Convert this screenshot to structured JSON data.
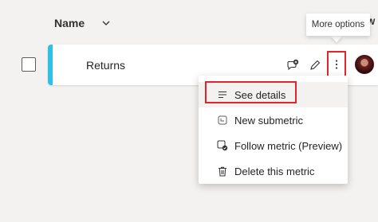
{
  "header": {
    "name_column": "Name",
    "edge_text": "W"
  },
  "row": {
    "name": "Returns",
    "accent_color": "#2fc1e5"
  },
  "tooltip": {
    "text": "More options"
  },
  "menu": {
    "items": [
      {
        "label": "See details",
        "icon": "details-lines-icon"
      },
      {
        "label": "New submetric",
        "icon": "submetric-icon"
      },
      {
        "label": "Follow metric (Preview)",
        "icon": "follow-metric-icon"
      },
      {
        "label": "Delete this metric",
        "icon": "trash-icon"
      }
    ]
  },
  "highlight_color": "#e3242b"
}
